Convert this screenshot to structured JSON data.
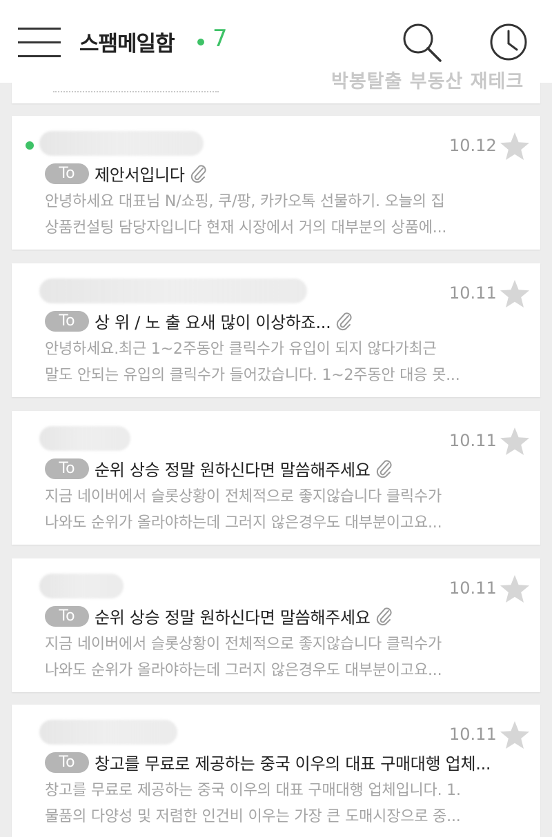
{
  "header": {
    "title": "스팸메일함",
    "count": "7",
    "watermark": "박봉탈출 부동산 재테크",
    "accent_color": "#3ec267",
    "icons": [
      "menu-icon",
      "search-icon",
      "clock-icon"
    ]
  },
  "emails": [
    {
      "date": "10.12",
      "unread": true,
      "subject": "제안서입니다",
      "has_attachment": true,
      "preview_line1": "안녕하세요 대표님 N/쇼핑, 쿠/팡, 카카오톡 선물하기. 오늘의 집",
      "preview_line2": "상품컨설팅 담당자입니다 현재 시장에서 거의 대부분의 상품에..."
    },
    {
      "date": "10.11",
      "unread": false,
      "subject": "상 위 / 노 출 요새 많이 이상하죠...",
      "has_attachment": true,
      "preview_line1": "안녕하세요.최근 1~2주동안 클릭수가 유입이 되지 않다가최근",
      "preview_line2": "말도 안되는 유입의 클릭수가 들어갔습니다. 1~2주동안 대응 못..."
    },
    {
      "date": "10.11",
      "unread": false,
      "subject": "순위 상승 정말 원하신다면 말씀해주세요",
      "has_attachment": true,
      "preview_line1": "지금 네이버에서 슬롯상황이 전체적으로 좋지않습니다 클릭수가",
      "preview_line2": "나와도 순위가 올라야하는데 그러지 않은경우도 대부분이고요..."
    },
    {
      "date": "10.11",
      "unread": false,
      "subject": "순위 상승 정말 원하신다면 말씀해주세요",
      "has_attachment": true,
      "preview_line1": "지금 네이버에서 슬롯상황이 전체적으로 좋지않습니다 클릭수가",
      "preview_line2": "나와도 순위가 올라야하는데 그러지 않은경우도 대부분이고요..."
    },
    {
      "date": "10.11",
      "unread": false,
      "subject": "창고를 무료로 제공하는 중국 이우의 대표 구매대행 업체...",
      "has_attachment": false,
      "preview_line1": "창고를 무료로 제공하는 중국 이우의 대표 구매대행 업체입니다. 1.",
      "preview_line2": "물품의 다양성 및 저렴한 인건비 이우는 가장 큰 도매시장으로 중..."
    }
  ],
  "to_label": "To"
}
